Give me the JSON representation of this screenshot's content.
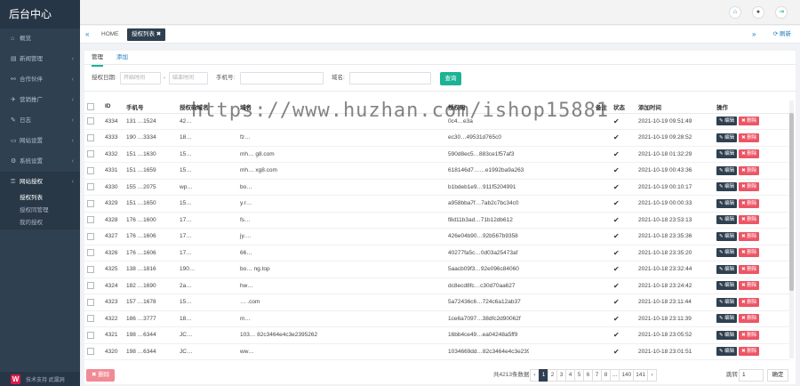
{
  "sidebar": {
    "brand": "后台中心",
    "items": [
      {
        "label": "概览",
        "icon": "home-icon",
        "glyph": "⌂",
        "chev": ""
      },
      {
        "label": "新闻管理",
        "icon": "list-icon",
        "glyph": "▤",
        "chev": "‹"
      },
      {
        "label": "合作伙伴",
        "icon": "link-icon",
        "glyph": "⚯",
        "chev": "‹"
      },
      {
        "label": "营销推广",
        "icon": "megaphone-icon",
        "glyph": "✈",
        "chev": "‹"
      },
      {
        "label": "日志",
        "icon": "edit-icon",
        "glyph": "✎",
        "chev": "‹"
      },
      {
        "label": "网站设置",
        "icon": "monitor-icon",
        "glyph": "▭",
        "chev": "‹"
      },
      {
        "label": "系统设置",
        "icon": "cogs-icon",
        "glyph": "⚙",
        "chev": "‹"
      },
      {
        "label": "网站授权",
        "icon": "key-icon",
        "glyph": "⚿",
        "chev": "‹"
      }
    ],
    "subitems": [
      "授权列表",
      "授权同管理",
      "我的授权"
    ],
    "footer": "技术支持 武漏洞"
  },
  "header": {
    "home_glyph": "⌂",
    "user_glyph": "●",
    "logout_glyph": "⇥"
  },
  "tabsbar": {
    "prev": "«",
    "home": "HOME",
    "active": "授权列表 ✖",
    "next": "»",
    "refresh": "⟳ 刷新"
  },
  "subtabs": {
    "manage": "管理",
    "add": "添加"
  },
  "search": {
    "date_label": "授权日期:",
    "start_placeholder": "开始时间",
    "sep": "-",
    "end_placeholder": "结束时间",
    "phone_label": "手机号:",
    "domain_label": "域名:",
    "query": "查询"
  },
  "table": {
    "headers": [
      "ID",
      "手机号",
      "授权码域名",
      "域名",
      "授权码",
      "备注",
      "状态",
      "添加时间",
      "操作"
    ],
    "edit_label": "✎ 编辑",
    "del_label": "✖ 删除",
    "status_glyph": "✔",
    "rows": [
      {
        "id": "4334",
        "phone": "131 …1524",
        "a": "42…",
        "b": "",
        "c": "0c4…e3a",
        "d": "2021-10-19 09:51:49"
      },
      {
        "id": "4333",
        "phone": "190 …3334",
        "a": "18…",
        "b": "fz…",
        "c": "ec30…49531d765c0",
        "d": "2021-10-19 09:28:52"
      },
      {
        "id": "4332",
        "phone": "151 …1630",
        "a": "15…",
        "b": "mh… g8.com",
        "c": "590d8ec5…883ce1f57af3",
        "d": "2021-10-18 01:32:29"
      },
      {
        "id": "4331",
        "phone": "151 …1659",
        "a": "15…",
        "b": "mh… xg8.com",
        "c": "618146d7……e1992ba9a263",
        "d": "2021-10-19 00:43:36"
      },
      {
        "id": "4330",
        "phone": "155 …2075",
        "a": "wp…",
        "b": "bo…",
        "c": "b1bdeb1e9…911f5204991",
        "d": "2021-10-19 00:10:17"
      },
      {
        "id": "4329",
        "phone": "151 …1650",
        "a": "15…",
        "b": "y.r…",
        "c": "a958bba7f…7ab2c7bc34c0",
        "d": "2021-10-19 00:00:33"
      },
      {
        "id": "4328",
        "phone": "176 …1600",
        "a": "17…",
        "b": "fs…",
        "c": "f8d11b3ad…71b12db612",
        "d": "2021-10-18 23:53:13"
      },
      {
        "id": "4327",
        "phone": "176 …1606",
        "a": "17…",
        "b": "jy.…",
        "c": "426e04b90…92b567b9358",
        "d": "2021-10-18 23:35:36"
      },
      {
        "id": "4326",
        "phone": "176 …1606",
        "a": "17…",
        "b": "66…",
        "c": "40277fa5c…0d03a25473af",
        "d": "2021-10-18 23:35:20"
      },
      {
        "id": "4325",
        "phone": "138 …1816",
        "b": "bo… ng.top",
        "a": "190…",
        "c": "5aacb09f3…92e096c84060",
        "d": "2021-10-18 23:32:44"
      },
      {
        "id": "4324",
        "phone": "182 …1690",
        "a": "2a…",
        "b": "hw…",
        "c": "dc8ecd8fc…c30d70aa627",
        "d": "2021-10-18 23:24:42"
      },
      {
        "id": "4323",
        "phone": "157 …1678",
        "a": "15…",
        "b": "… .com",
        "c": "5a72436c6…724c6a12ab37",
        "d": "2021-10-18 23:11:44"
      },
      {
        "id": "4322",
        "phone": "186 …3777",
        "a": "18…",
        "b": "m…",
        "c": "1ce6a7097…38dfc2d90062f",
        "d": "2021-10-18 23:11:39"
      },
      {
        "id": "4321",
        "phone": "198 …6344",
        "a": "JC…",
        "b": "103… 82c3464e4c3e2395262",
        "c": "16bb4ce49…ea04248a5ff9",
        "d": "2021-10-18 23:05:52"
      },
      {
        "id": "4320",
        "phone": "198 …6344",
        "a": "JC…",
        "b": "ww…",
        "c": "1034669dd…82c3464e4c3e2395262",
        "d": "2021-10-18 23:01:51"
      }
    ]
  },
  "footer": {
    "bulk_delete": "✖ 删除",
    "total": "共4213条数据",
    "pages": [
      "‹",
      "1",
      "2",
      "3",
      "4",
      "5",
      "6",
      "7",
      "8",
      "...",
      "140",
      "141",
      "›"
    ],
    "goto_label": "跳转",
    "goto_value": "1",
    "goto_unit": "页",
    "confirm": "确定"
  },
  "watermark": "https://www.huzhan.com/ishop15881"
}
